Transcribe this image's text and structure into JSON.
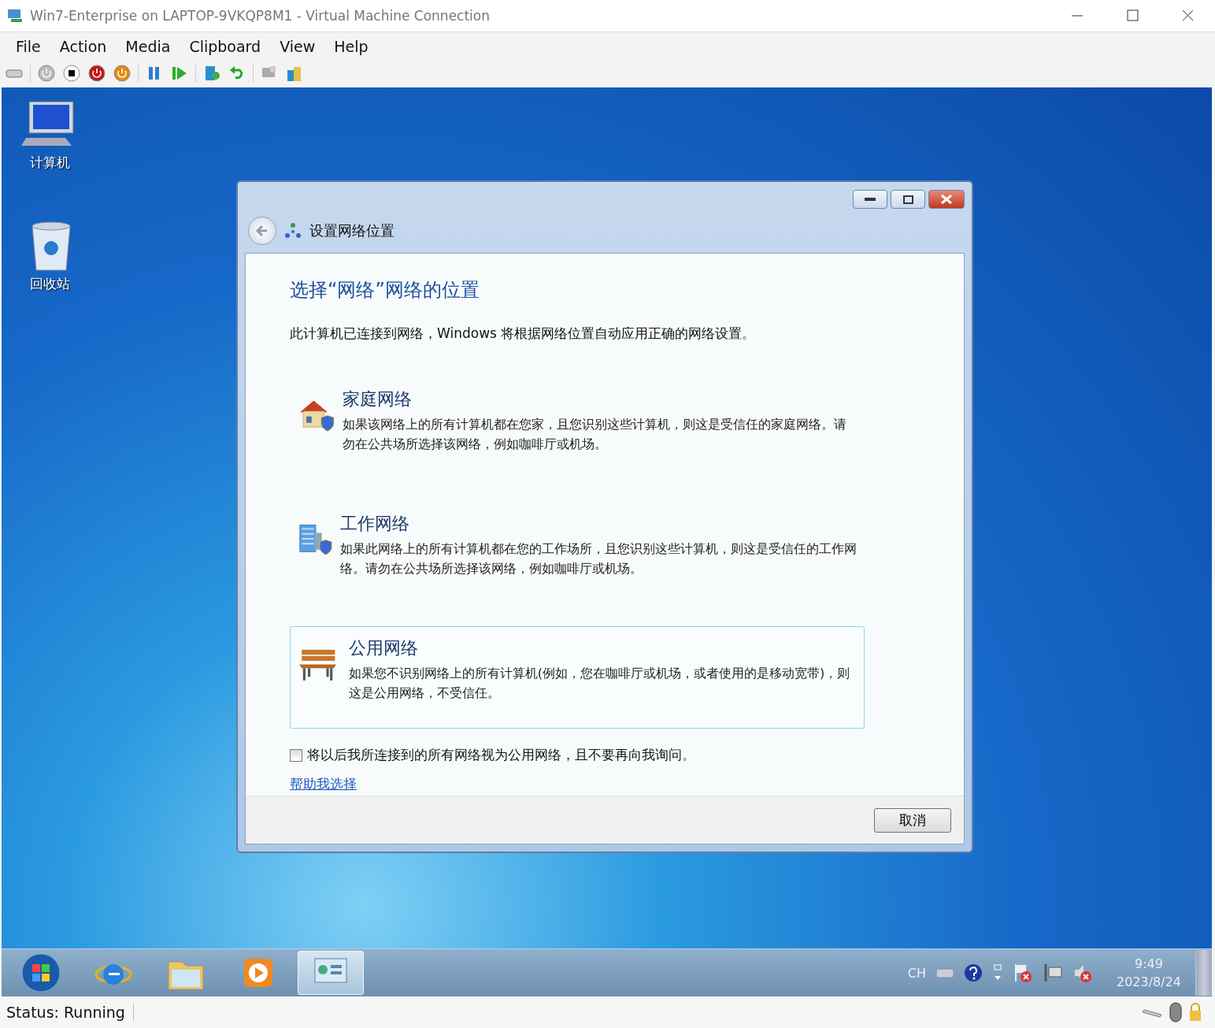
{
  "window": {
    "title": "Win7-Enterprise on LAPTOP-9VKQP8M1 - Virtual Machine Connection"
  },
  "menu": [
    "File",
    "Action",
    "Media",
    "Clipboard",
    "View",
    "Help"
  ],
  "desktop_icons": [
    {
      "kind": "computer",
      "label": "计算机"
    },
    {
      "kind": "recycle-bin",
      "label": "回收站"
    }
  ],
  "dialog": {
    "nav_title": "设置网络位置",
    "heading": "选择“网络”网络的位置",
    "intro": "此计算机已连接到网络，Windows 将根据网络位置自动应用正确的网络设置。",
    "options": [
      {
        "kind": "home",
        "title": "家庭网络",
        "description": "如果该网络上的所有计算机都在您家，且您识别这些计算机，则这是受信任的家庭网络。请勿在公共场所选择该网络，例如咖啡厅或机场。",
        "selected": false
      },
      {
        "kind": "work",
        "title": "工作网络",
        "description": "如果此网络上的所有计算机都在您的工作场所，且您识别这些计算机，则这是受信任的工作网络。请勿在公共场所选择该网络，例如咖啡厅或机场。",
        "selected": false
      },
      {
        "kind": "public",
        "title": "公用网络",
        "description": "如果您不识别网络上的所有计算机(例如，您在咖啡厅或机场，或者使用的是移动宽带)，则这是公用网络，不受信任。",
        "selected": true
      }
    ],
    "checkbox": {
      "label": "将以后我所连接到的所有网络视为公用网络，且不要再向我询问。",
      "checked": false
    },
    "help_link": "帮助我选择",
    "cancel_button": "取消"
  },
  "taskbar": {
    "items": [
      {
        "kind": "start",
        "selected": false
      },
      {
        "kind": "browser",
        "selected": false
      },
      {
        "kind": "folder",
        "selected": false
      },
      {
        "kind": "media",
        "selected": false
      },
      {
        "kind": "network",
        "selected": true
      }
    ],
    "language": "CH",
    "time": "9:49",
    "date": "2023/8/24"
  },
  "status_bar": {
    "status": "Status: Running"
  }
}
